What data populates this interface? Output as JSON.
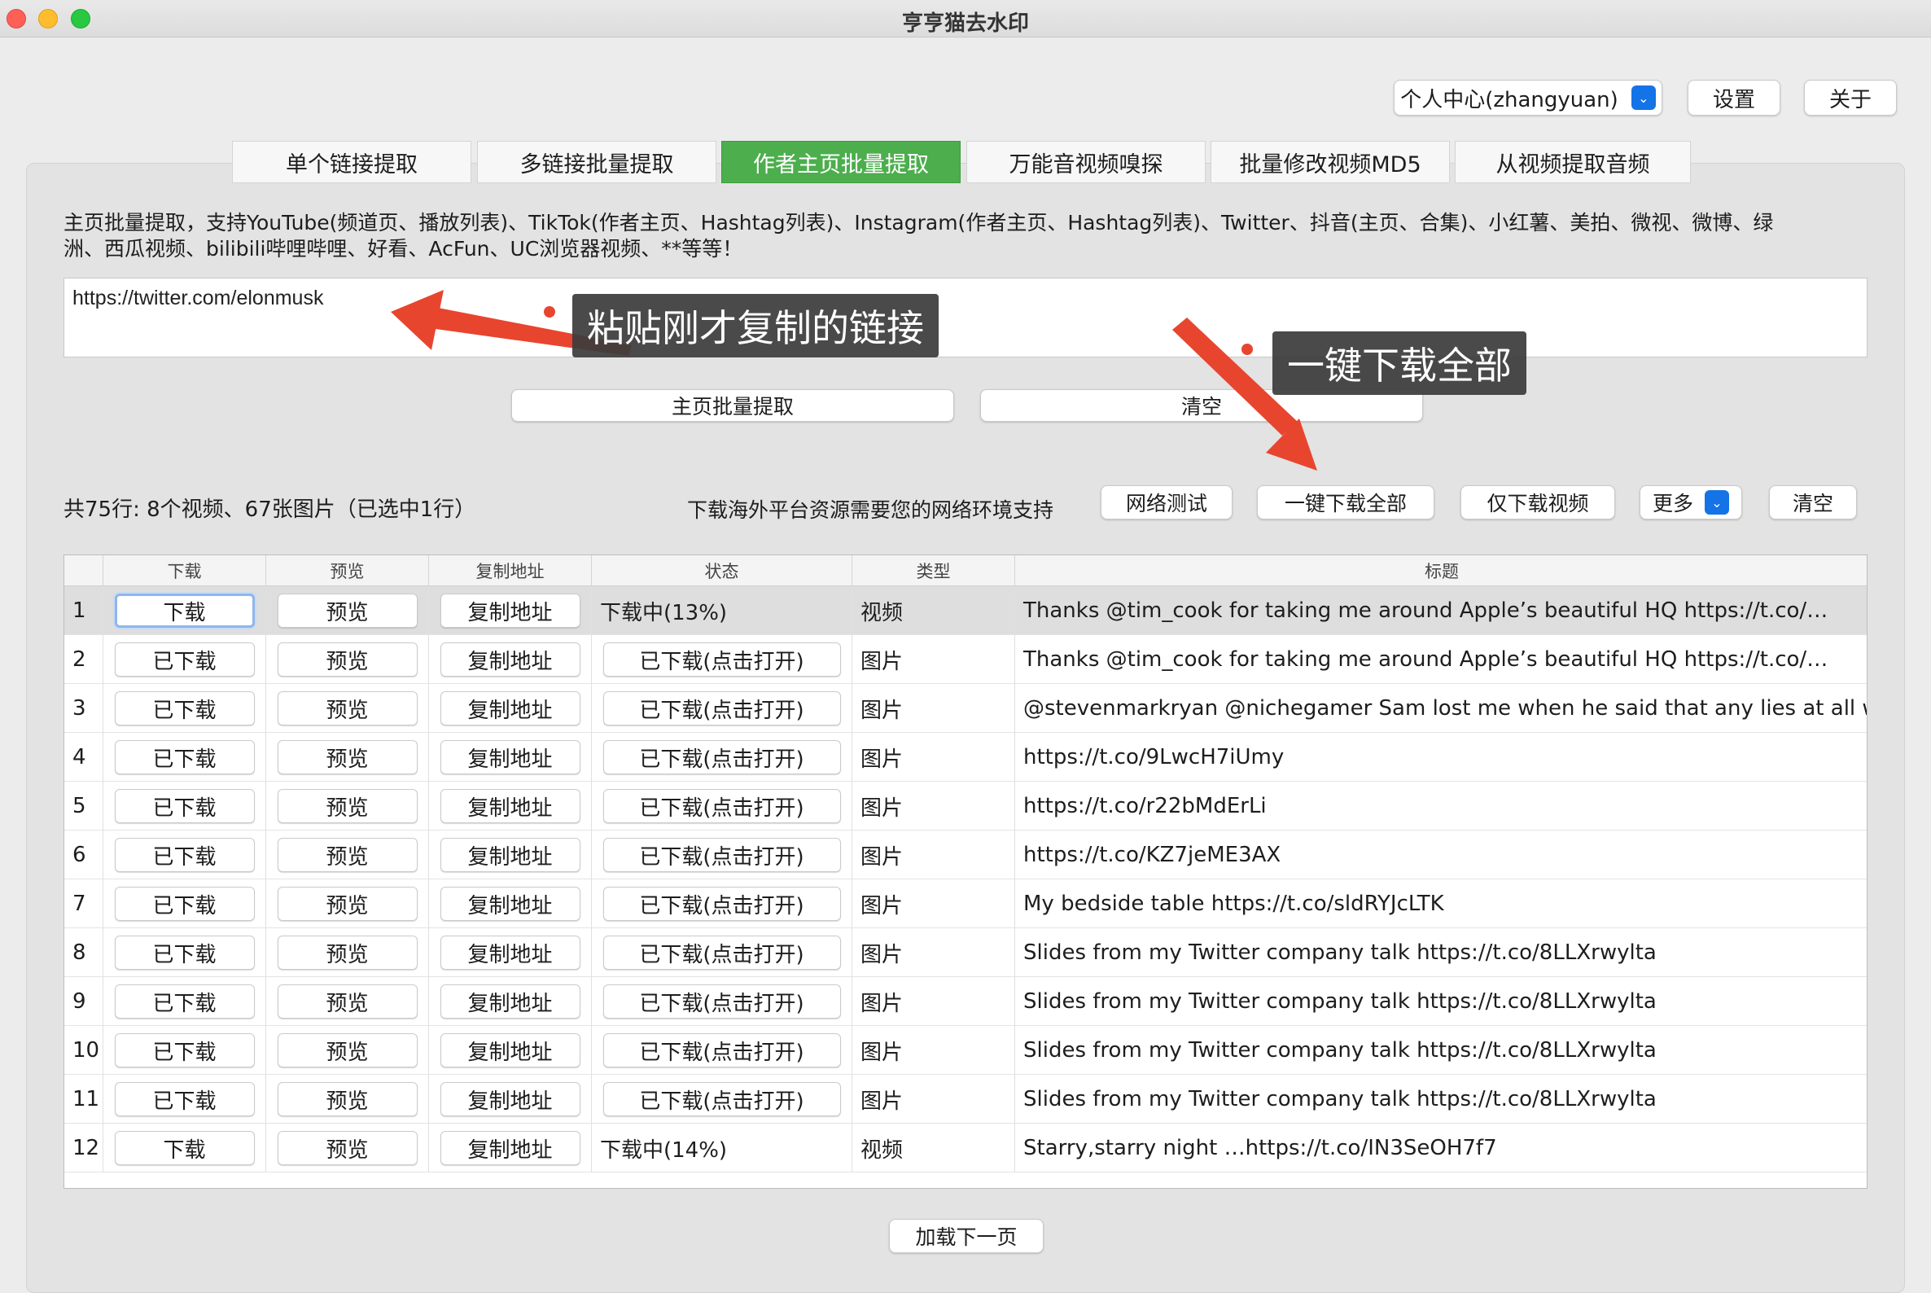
{
  "window": {
    "title": "亨亨猫去水印"
  },
  "top_controls": {
    "user_select": "个人中心(zhangyuan)",
    "settings_label": "设置",
    "about_label": "关于"
  },
  "tabs": [
    {
      "label": "单个链接提取"
    },
    {
      "label": "多链接批量提取"
    },
    {
      "label": "作者主页批量提取",
      "active": true
    },
    {
      "label": "万能音视频嗅探"
    },
    {
      "label": "批量修改视频MD5"
    },
    {
      "label": "从视频提取音频"
    }
  ],
  "main": {
    "description_line1": "主页批量提取，支持YouTube(频道页、播放列表)、TikTok(作者主页、Hashtag列表)、Instagram(作者主页、Hashtag列表)、Twitter、抖音(主页、合集)、小红薯、美拍、微视、微博、绿",
    "description_line2": "洲、西瓜视频、bilibili哔哩哔哩、好看、AcFun、UC浏览器视频、**等等！",
    "url_value": "https://twitter.com/elonmusk",
    "extract_button": "主页批量提取",
    "clear_button": "清空"
  },
  "annotations": {
    "paste_hint": "粘贴刚才复制的链接",
    "download_all_hint": "一键下载全部",
    "arrow_color": "#e8452f"
  },
  "status": {
    "summary": "共75行: 8个视频、67张图片（已选中1行）",
    "network_hint": "下载海外平台资源需要您的网络环境支持",
    "network_test": "网络测试",
    "download_all": "一键下载全部",
    "download_videos_only": "仅下载视频",
    "more_select": "更多",
    "clear": "清空"
  },
  "table": {
    "columns": [
      "下载",
      "预览",
      "复制地址",
      "状态",
      "类型",
      "标题"
    ],
    "rows": [
      {
        "index": "1",
        "download": "下载",
        "preview": "预览",
        "copy": "复制地址",
        "status": "下载中(13%)",
        "status_is_button": false,
        "type": "视频",
        "title": "Thanks @tim_cook for taking me around Apple’s beautiful HQ https://t.co/…"
      },
      {
        "index": "2",
        "download": "已下载",
        "preview": "预览",
        "copy": "复制地址",
        "status": "已下载(点击打开)",
        "status_is_button": true,
        "type": "图片",
        "title": "Thanks @tim_cook for taking me around Apple’s beautiful HQ https://t.co/…"
      },
      {
        "index": "3",
        "download": "已下载",
        "preview": "预览",
        "copy": "复制地址",
        "status": "已下载(点击打开)",
        "status_is_button": true,
        "type": "图片",
        "title": "@stevenmarkryan @nichegamer Sam lost me when he said that any lies at all woul…"
      },
      {
        "index": "4",
        "download": "已下载",
        "preview": "预览",
        "copy": "复制地址",
        "status": "已下载(点击打开)",
        "status_is_button": true,
        "type": "图片",
        "title": "https://t.co/9LwcH7iUmy"
      },
      {
        "index": "5",
        "download": "已下载",
        "preview": "预览",
        "copy": "复制地址",
        "status": "已下载(点击打开)",
        "status_is_button": true,
        "type": "图片",
        "title": "https://t.co/r22bMdErLi"
      },
      {
        "index": "6",
        "download": "已下载",
        "preview": "预览",
        "copy": "复制地址",
        "status": "已下载(点击打开)",
        "status_is_button": true,
        "type": "图片",
        "title": "https://t.co/KZ7jeME3AX"
      },
      {
        "index": "7",
        "download": "已下载",
        "preview": "预览",
        "copy": "复制地址",
        "status": "已下载(点击打开)",
        "status_is_button": true,
        "type": "图片",
        "title": "My bedside table https://t.co/sldRYJcLTK"
      },
      {
        "index": "8",
        "download": "已下载",
        "preview": "预览",
        "copy": "复制地址",
        "status": "已下载(点击打开)",
        "status_is_button": true,
        "type": "图片",
        "title": "Slides from my Twitter company talk https://t.co/8LLXrwylta"
      },
      {
        "index": "9",
        "download": "已下载",
        "preview": "预览",
        "copy": "复制地址",
        "status": "已下载(点击打开)",
        "status_is_button": true,
        "type": "图片",
        "title": "Slides from my Twitter company talk https://t.co/8LLXrwylta"
      },
      {
        "index": "10",
        "download": "已下载",
        "preview": "预览",
        "copy": "复制地址",
        "status": "已下载(点击打开)",
        "status_is_button": true,
        "type": "图片",
        "title": "Slides from my Twitter company talk https://t.co/8LLXrwylta"
      },
      {
        "index": "11",
        "download": "已下载",
        "preview": "预览",
        "copy": "复制地址",
        "status": "已下载(点击打开)",
        "status_is_button": true,
        "type": "图片",
        "title": "Slides from my Twitter company talk https://t.co/8LLXrwylta"
      },
      {
        "index": "12",
        "download": "下载",
        "preview": "预览",
        "copy": "复制地址",
        "status": "下载中(14%)",
        "status_is_button": false,
        "type": "视频",
        "title": "Starry,starry night …https://t.co/IN3SeOH7f7"
      }
    ]
  },
  "footer": {
    "load_next": "加载下一页"
  },
  "colors": {
    "tab_active": "#4cae4c",
    "select_accent": "#1473e6"
  }
}
